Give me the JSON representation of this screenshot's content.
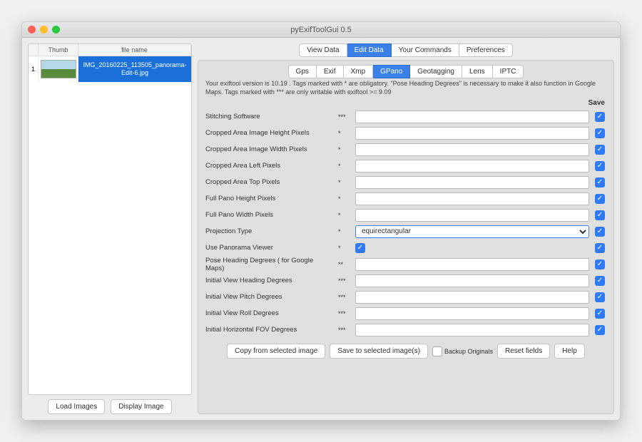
{
  "window": {
    "title": "pyExifToolGui 0.5"
  },
  "left": {
    "headers": {
      "index": "",
      "thumb": "Thumb",
      "filename": "file name"
    },
    "row": {
      "index": "1",
      "filename": "IMG_20160225_113505_panorama-Edit-6.jpg"
    },
    "buttons": {
      "load": "Load Images",
      "display": "Display Image"
    }
  },
  "main_tabs": [
    {
      "label": "View Data",
      "active": false
    },
    {
      "label": "Edit Data",
      "active": true
    },
    {
      "label": "Your Commands",
      "active": false
    },
    {
      "label": "Preferences",
      "active": false
    }
  ],
  "sub_tabs": [
    {
      "label": "Gps",
      "active": false
    },
    {
      "label": "Exif",
      "active": false
    },
    {
      "label": "Xmp",
      "active": false
    },
    {
      "label": "GPano",
      "active": true
    },
    {
      "label": "Geotagging",
      "active": false
    },
    {
      "label": "Lens",
      "active": false
    },
    {
      "label": "IPTC",
      "active": false
    }
  ],
  "info_text": "Your exiftool version is 10.19 . Tags marked with * are obligatory. \"Pose Heading Degrees\" is necessary to make it also function in Google Maps. Tags marked with *** are only writable with exiftool >= 9.09",
  "save_header": "Save",
  "fields": [
    {
      "label": "Stitching Software",
      "mark": "***",
      "type": "text",
      "value": "",
      "save": true
    },
    {
      "label": "Cropped Area Image Height Pixels",
      "mark": "*",
      "type": "text",
      "value": "",
      "save": true
    },
    {
      "label": "Cropped Area Image Width Pixels",
      "mark": "*",
      "type": "text",
      "value": "",
      "save": true
    },
    {
      "label": "Cropped Area Left Pixels",
      "mark": "*",
      "type": "text",
      "value": "",
      "save": true
    },
    {
      "label": "Cropped Area Top Pixels",
      "mark": "*",
      "type": "text",
      "value": "",
      "save": true
    },
    {
      "label": "Full Pano Height Pixels",
      "mark": "*",
      "type": "text",
      "value": "",
      "save": true
    },
    {
      "label": "Full Pano Width Pixels",
      "mark": "*",
      "type": "text",
      "value": "",
      "save": true
    },
    {
      "label": "Projection Type",
      "mark": "*",
      "type": "select",
      "value": "equirectangular",
      "save": true
    },
    {
      "label": "Use Panorama Viewer",
      "mark": "*",
      "type": "checkbox",
      "value": true,
      "save": true
    },
    {
      "label": "Pose Heading Degrees ( for Google Maps)",
      "mark": "**",
      "type": "text",
      "value": "",
      "save": true
    },
    {
      "label": "Initial View Heading Degrees",
      "mark": "***",
      "type": "text",
      "value": "",
      "save": true
    },
    {
      "label": "Initial View Pitch Degrees",
      "mark": "***",
      "type": "text",
      "value": "",
      "save": true
    },
    {
      "label": "Initial View Roll Degrees",
      "mark": "***",
      "type": "text",
      "value": "",
      "save": true
    },
    {
      "label": "Initial Horizontal FOV Degrees",
      "mark": "***",
      "type": "text",
      "value": "",
      "save": true
    }
  ],
  "bottom": {
    "copy": "Copy from selected image",
    "save": "Save to selected image(s)",
    "backup_label": "Backup Originals",
    "backup_checked": false,
    "reset": "Reset fields",
    "help": "Help"
  }
}
